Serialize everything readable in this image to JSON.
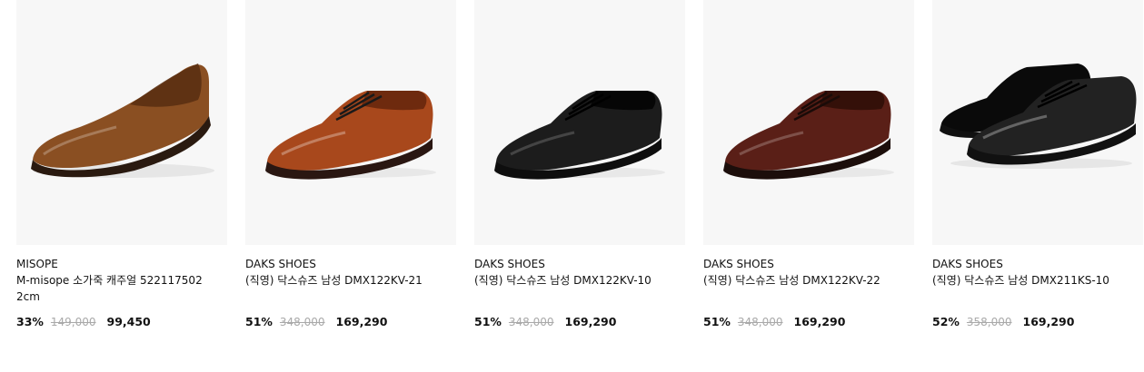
{
  "products": [
    {
      "brand": "MISOPE",
      "name": "M-misope 소가죽 캐주얼 522117502 2cm",
      "discount": "33%",
      "original_price": "149,000",
      "sale_price": "99,450",
      "image": "brown-leather-loafer",
      "colors": {
        "upper": "#8a4f22",
        "shade": "#5a2f12",
        "sole": "#2a1a10"
      }
    },
    {
      "brand": "DAKS SHOES",
      "name": "(직영) 닥스슈즈 남성 DMX122KV-21",
      "discount": "51%",
      "original_price": "348,000",
      "sale_price": "169,290",
      "image": "tan-derby-shoe",
      "colors": {
        "upper": "#a8481c",
        "shade": "#6e2a0e",
        "sole": "#2a1712"
      }
    },
    {
      "brand": "DAKS SHOES",
      "name": "(직영) 닥스슈즈 남성 DMX122KV-10",
      "discount": "51%",
      "original_price": "348,000",
      "sale_price": "169,290",
      "image": "black-derby-shoe",
      "colors": {
        "upper": "#1c1c1c",
        "shade": "#060606",
        "sole": "#0e0e0e"
      }
    },
    {
      "brand": "DAKS SHOES",
      "name": "(직영) 닥스슈즈 남성 DMX122KV-22",
      "discount": "51%",
      "original_price": "348,000",
      "sale_price": "169,290",
      "image": "dark-brown-derby-shoe",
      "colors": {
        "upper": "#5a1f17",
        "shade": "#341009",
        "sole": "#1c0e0b"
      }
    },
    {
      "brand": "DAKS SHOES",
      "name": "(직영) 닥스슈즈 남성 DMX211KS-10",
      "discount": "52%",
      "original_price": "358,000",
      "sale_price": "169,290",
      "image": "black-derby-shoe-pair",
      "colors": {
        "upper": "#222222",
        "shade": "#0a0a0a",
        "sole": "#111111"
      }
    }
  ]
}
